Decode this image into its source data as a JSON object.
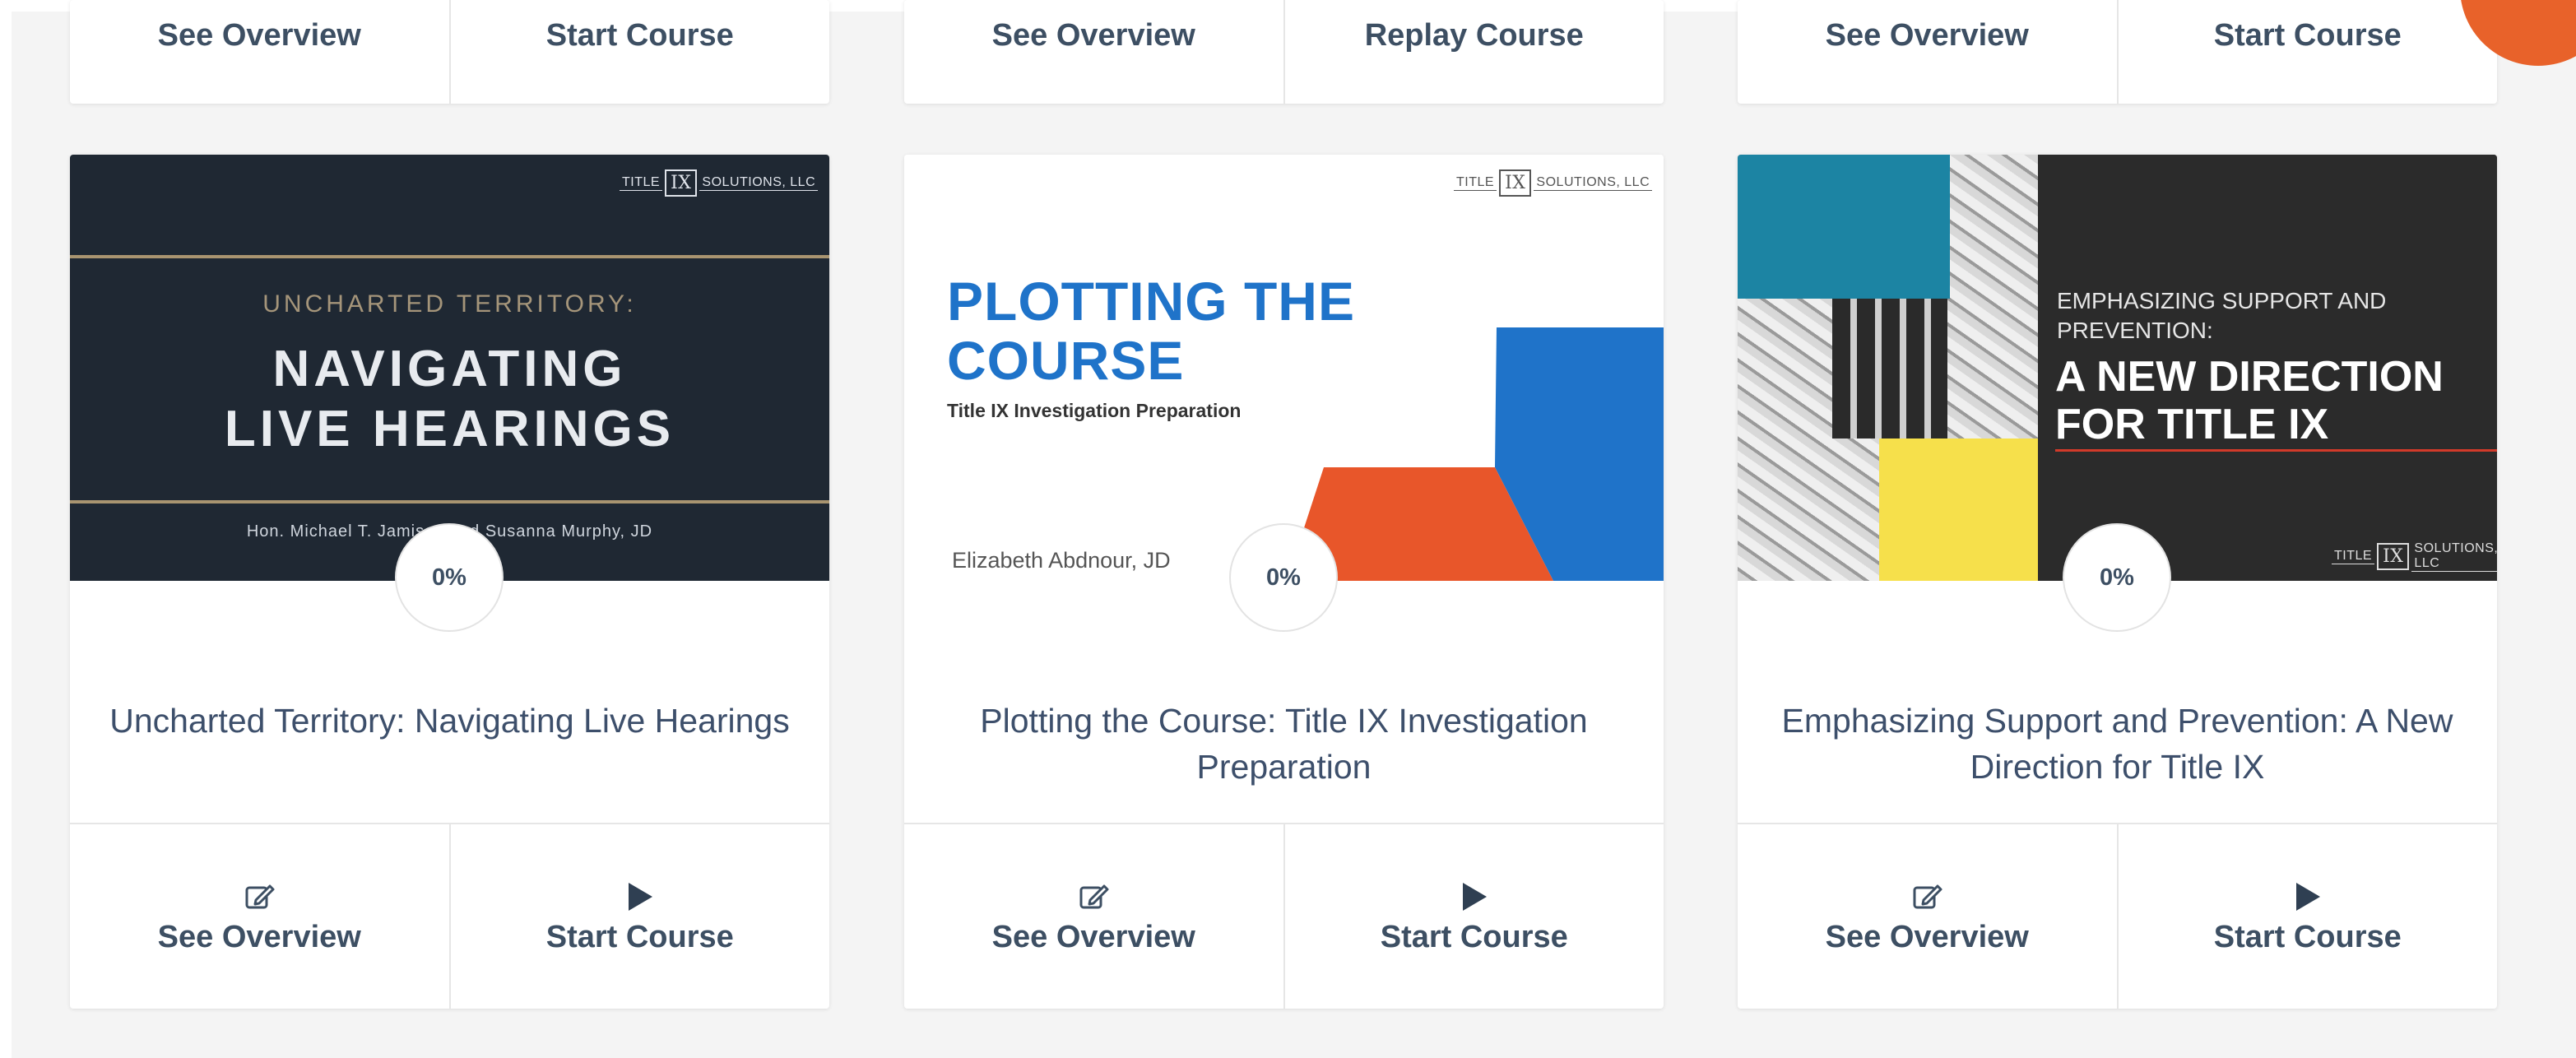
{
  "top_row": [
    {
      "overview_label": "See Overview",
      "action_label": "Start Course"
    },
    {
      "overview_label": "See Overview",
      "action_label": "Replay Course"
    },
    {
      "overview_label": "See Overview",
      "action_label": "Start Course"
    }
  ],
  "courses": [
    {
      "title": "Uncharted Territory: Navigating Live Hearings",
      "progress": "0%",
      "overview_label": "See Overview",
      "action_label": "Start Course",
      "thumb": {
        "logo_left": "TITLE",
        "logo_ix": "IX",
        "logo_right": "SOLUTIONS, LLC",
        "kicker": "UNCHARTED TERRITORY:",
        "line1": "NAVIGATING",
        "line2": "LIVE HEARINGS",
        "authors": "Hon. Michael T. Jamison and Susanna Murphy, JD"
      }
    },
    {
      "title": "Plotting the Course: Title IX Investigation Preparation",
      "progress": "0%",
      "overview_label": "See Overview",
      "action_label": "Start Course",
      "thumb": {
        "logo_left": "TITLE",
        "logo_ix": "IX",
        "logo_right": "SOLUTIONS, LLC",
        "line1": "PLOTTING THE",
        "line2": "COURSE",
        "subtitle": "Title IX Investigation Preparation",
        "author": "Elizabeth Abdnour, JD"
      }
    },
    {
      "title": "Emphasizing Support and Prevention: A New Direction for Title IX",
      "progress": "0%",
      "overview_label": "See Overview",
      "action_label": "Start Course",
      "thumb": {
        "logo_left": "TITLE",
        "logo_ix": "IX",
        "logo_right": "SOLUTIONS, LLC",
        "kicker1": "EMPHASIZING SUPPORT AND",
        "kicker2": "PREVENTION:",
        "line1": "A NEW DIRECTION",
        "line2": "FOR TITLE IX"
      }
    }
  ],
  "colors": {
    "accent_orange": "#e8622a",
    "blue": "#1a6ec2",
    "dark_navy": "#1f2833",
    "yellow": "#f6e04b",
    "teal": "#1c84a3",
    "text": "#3d4f63"
  },
  "icons": {
    "overview": "edit-icon",
    "start": "play-icon"
  }
}
